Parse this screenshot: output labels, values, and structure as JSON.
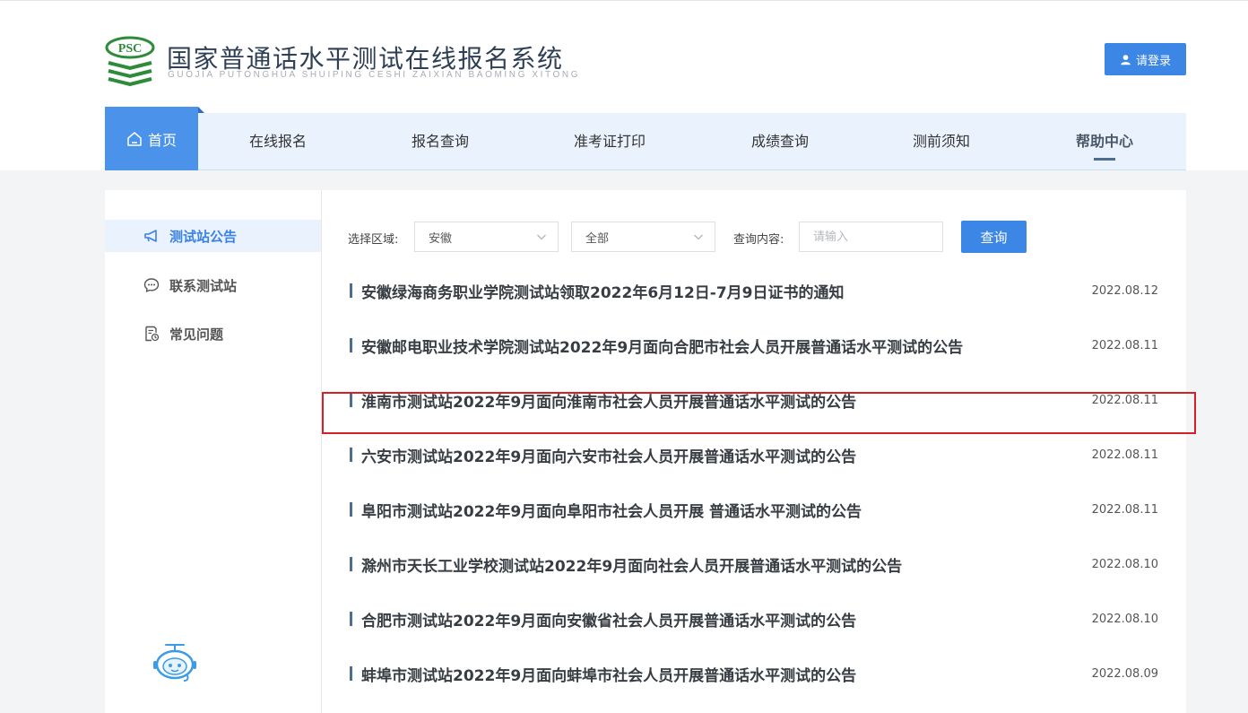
{
  "header": {
    "logo_text": "PSC",
    "title": "国家普通话水平测试在线报名系统",
    "subtitle": "GUOJIA PUTONGHUA SHUIPING CESHI ZAIXIAN BAOMING XITONG",
    "login_label": "请登录"
  },
  "nav": {
    "home": "首页",
    "items": [
      "在线报名",
      "报名查询",
      "准考证打印",
      "成绩查询",
      "测前须知",
      "帮助中心"
    ],
    "active": "帮助中心"
  },
  "sidebar": {
    "items": [
      "测试站公告",
      "联系测试站",
      "常见问题"
    ],
    "active": "测试站公告"
  },
  "filter": {
    "region_label": "选择区域:",
    "region_value": "安徽",
    "sub_value": "全部",
    "query_label": "查询内容:",
    "query_placeholder": "请输入",
    "query_button": "查询"
  },
  "announcements": [
    {
      "title": "安徽绿海商务职业学院测试站领取2022年6月12日-7月9日证书的通知",
      "date": "2022.08.12"
    },
    {
      "title": "安徽邮电职业技术学院测试站2022年9月面向合肥市社会人员开展普通话水平测试的公告",
      "date": "2022.08.11"
    },
    {
      "title": "淮南市测试站2022年9月面向淮南市社会人员开展普通话水平测试的公告",
      "date": "2022.08.11"
    },
    {
      "title": "六安市测试站2022年9月面向六安市社会人员开展普通话水平测试的公告",
      "date": "2022.08.11"
    },
    {
      "title": "阜阳市测试站2022年9月面向阜阳市社会人员开展 普通话水平测试的公告",
      "date": "2022.08.11"
    },
    {
      "title": "滁州市天长工业学校测试站2022年9月面向社会人员开展普通话水平测试的公告",
      "date": "2022.08.10"
    },
    {
      "title": "合肥市测试站2022年9月面向安徽省社会人员开展普通话水平测试的公告",
      "date": "2022.08.10"
    },
    {
      "title": "蚌埠市测试站2022年9月面向蚌埠市社会人员开展普通话水平测试的公告",
      "date": "2022.08.09"
    }
  ],
  "colors": {
    "accent": "#3c86e6",
    "logo_green": "#2e8b3a",
    "highlight": "#d62027"
  }
}
